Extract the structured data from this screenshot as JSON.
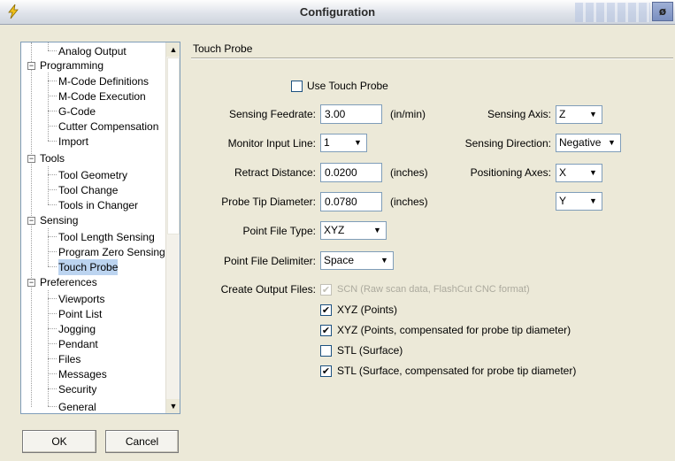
{
  "window": {
    "title": "Configuration",
    "close_label": "ø"
  },
  "tree": {
    "items": [
      {
        "label": "Analog Output"
      },
      {
        "label": "Programming"
      },
      {
        "label": "M-Code Definitions"
      },
      {
        "label": "M-Code Execution"
      },
      {
        "label": "G-Code"
      },
      {
        "label": "Cutter Compensation"
      },
      {
        "label": "Import"
      },
      {
        "label": "Tools"
      },
      {
        "label": "Tool Geometry"
      },
      {
        "label": "Tool Change"
      },
      {
        "label": "Tools in Changer"
      },
      {
        "label": "Sensing"
      },
      {
        "label": "Tool Length Sensing"
      },
      {
        "label": "Program Zero Sensing"
      },
      {
        "label": "Touch Probe"
      },
      {
        "label": "Preferences"
      },
      {
        "label": "Viewports"
      },
      {
        "label": "Point List"
      },
      {
        "label": "Jogging"
      },
      {
        "label": "Pendant"
      },
      {
        "label": "Files"
      },
      {
        "label": "Messages"
      },
      {
        "label": "Security"
      },
      {
        "label": "General"
      }
    ],
    "expander_symbol": "−"
  },
  "buttons": {
    "ok": "OK",
    "cancel": "Cancel"
  },
  "panel": {
    "title": "Touch Probe",
    "use_touch_probe": {
      "label": "Use Touch Probe",
      "checked": false
    },
    "sensing_feedrate": {
      "label": "Sensing Feedrate:",
      "value": "3.00",
      "unit": "(in/min)"
    },
    "monitor_input_line": {
      "label": "Monitor Input Line:",
      "value": "1"
    },
    "retract_distance": {
      "label": "Retract Distance:",
      "value": "0.0200",
      "unit": "(inches)"
    },
    "probe_tip_diameter": {
      "label": "Probe Tip Diameter:",
      "value": "0.0780",
      "unit": "(inches)"
    },
    "point_file_type": {
      "label": "Point File Type:",
      "value": "XYZ"
    },
    "point_file_delimiter": {
      "label": "Point File Delimiter:",
      "value": "Space"
    },
    "sensing_axis": {
      "label": "Sensing Axis:",
      "value": "Z"
    },
    "sensing_direction": {
      "label": "Sensing Direction:",
      "value": "Negative"
    },
    "positioning_axes": {
      "label": "Positioning Axes:",
      "value1": "X",
      "value2": "Y"
    },
    "create_output_files": {
      "label": "Create Output Files:",
      "options": [
        {
          "label": "SCN (Raw scan data, FlashCut CNC format)",
          "checked": true,
          "disabled": true
        },
        {
          "label": "XYZ (Points)",
          "checked": true,
          "disabled": false
        },
        {
          "label": "XYZ (Points, compensated for probe tip diameter)",
          "checked": true,
          "disabled": false
        },
        {
          "label": "STL (Surface)",
          "checked": false,
          "disabled": false
        },
        {
          "label": "STL (Surface, compensated for probe tip diameter)",
          "checked": true,
          "disabled": false
        }
      ]
    }
  }
}
